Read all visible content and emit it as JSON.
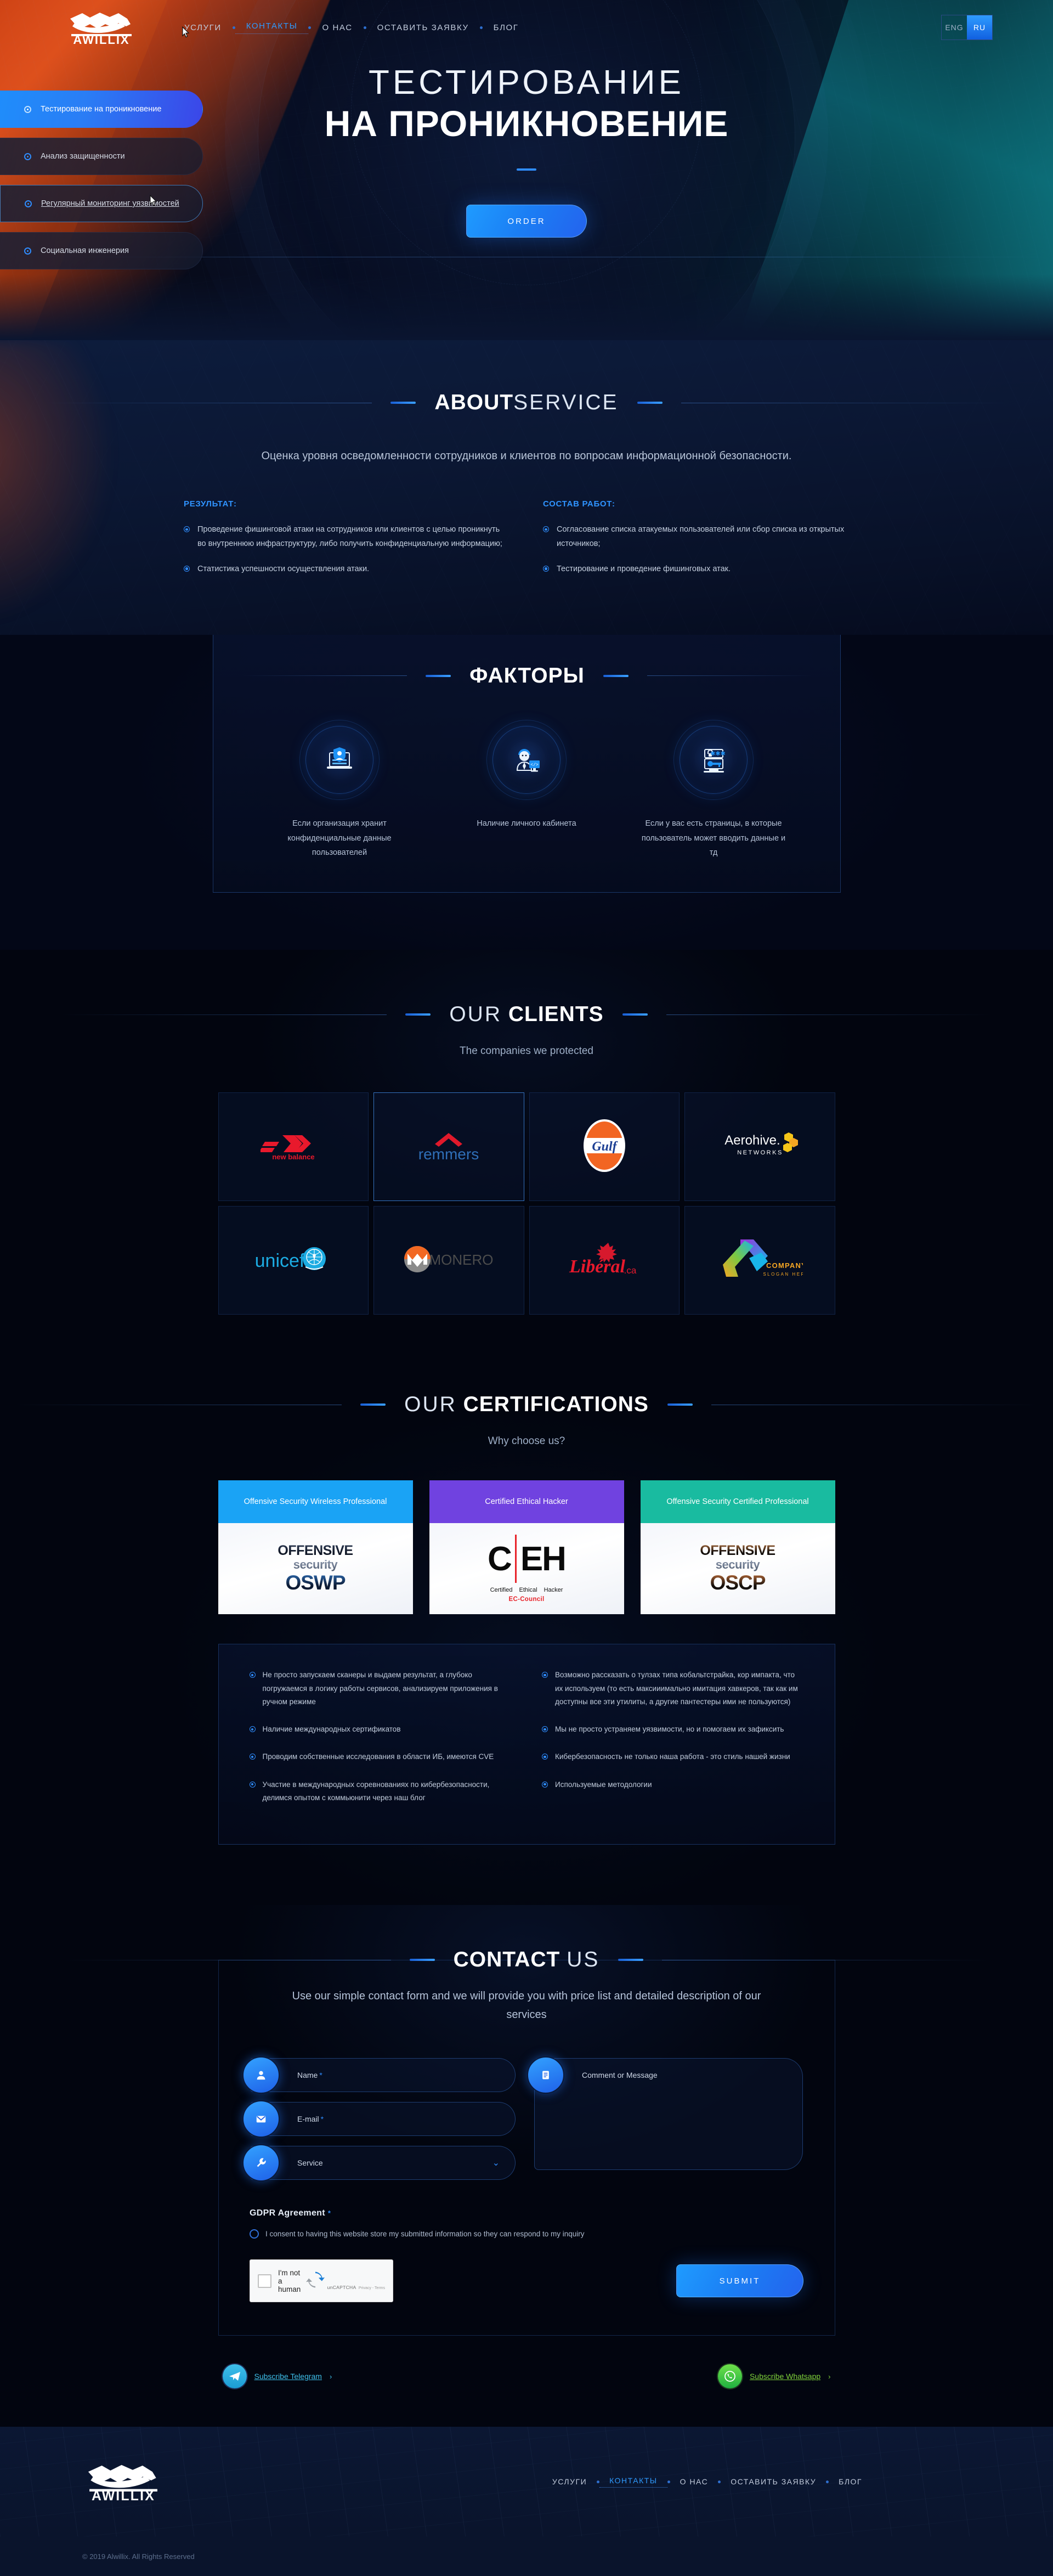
{
  "brand": {
    "name": "AWILLIX"
  },
  "nav": {
    "items": [
      {
        "label": "УСЛУГИ",
        "active": false
      },
      {
        "label": "КОНТАКТЫ",
        "active": true
      },
      {
        "label": "О НАС",
        "active": false
      },
      {
        "label": "ОСТАВИТЬ ЗАЯВКУ",
        "active": false
      },
      {
        "label": "БЛОГ",
        "active": false
      }
    ],
    "lang": {
      "eng": "ENG",
      "ru": "RU",
      "selected": "RU"
    }
  },
  "side_menu": {
    "items": [
      {
        "label": "Тестирование на проникновение",
        "state": "active"
      },
      {
        "label": "Анализ защищенности",
        "state": "normal"
      },
      {
        "label": "Регулярный мониторинг уязвимостей",
        "state": "hover"
      },
      {
        "label": "Социальная инженерия",
        "state": "normal"
      }
    ]
  },
  "hero": {
    "title_thin": "ТЕСТИРОВАНИЕ",
    "title_bold": "НА ПРОНИКНОВЕНИЕ",
    "cta": "ORDER"
  },
  "about": {
    "title_bold": "ABOUT",
    "title_light": "SERVICE",
    "lead": "Оценка уровня осведомленности сотрудников и клиентов по вопросам информационной безопасности.",
    "left": {
      "heading": "РЕЗУЛЬТАТ:",
      "items": [
        "Проведение фишинговой атаки на сотрудников или клиентов с целью проникнуть во внутреннюю инфраструктуру, либо получить конфиденциальную информацию;",
        "Статистика успешности осуществления атаки."
      ]
    },
    "right": {
      "heading": "СОСТАВ РАБОТ:",
      "items": [
        "Согласование списка атакуемых пользователей или сбор списка из открытых источников;",
        "Тестирование и проведение фишинговых атак."
      ]
    }
  },
  "factors": {
    "title": "ФАКТОРЫ",
    "cards": [
      {
        "icon": "laptop-shield-user-icon",
        "text": "Если организация хранит конфиденциальные данные пользователей"
      },
      {
        "icon": "user-developer-icon",
        "text": "Наличие личного кабинета"
      },
      {
        "icon": "password-lock-key-icon",
        "text": "Если у вас есть страницы, в которые пользователь может вводить данные и тд"
      }
    ]
  },
  "clients": {
    "title_light": "OUR",
    "title_bold": "CLIENTS",
    "subtitle": "The companies we protected",
    "logos": [
      {
        "name": "new balance",
        "id": "new-balance",
        "hl": false
      },
      {
        "name": "remmers",
        "id": "remmers",
        "hl": true
      },
      {
        "name": "Gulf",
        "id": "gulf",
        "hl": false
      },
      {
        "name": "Aerohive NETWORKS",
        "id": "aerohive",
        "hl": false
      },
      {
        "name": "unicef",
        "id": "unicef",
        "hl": false
      },
      {
        "name": "MONERO",
        "id": "monero",
        "hl": false
      },
      {
        "name": "Libéral.ca",
        "id": "liberal",
        "hl": false
      },
      {
        "name": "COMPANY SLOGAN HERE",
        "id": "company",
        "hl": false
      }
    ]
  },
  "certifications": {
    "title_light": "OUR",
    "title_bold": "CERTIFICATIONS",
    "subtitle": "Why choose us?",
    "cards": [
      {
        "header": "Offensive Security Wireless Professional",
        "color": "#1aa3f5",
        "logo": "oswp",
        "logo_top": "OFFENSIVE",
        "logo_mid": "security",
        "logo_big": "OSWP"
      },
      {
        "header": "Certified Ethical Hacker",
        "color": "#7042e0",
        "logo": "ceh",
        "ceh_c": "C",
        "ceh_eh": "EH",
        "ceh_sub1": "Certified",
        "ceh_sub2": "Ethical",
        "ceh_sub3": "Hacker",
        "ceh_ec": "EC-Council"
      },
      {
        "header": "Offensive Security Certified Professional",
        "color": "#19bba0",
        "logo": "oscp",
        "logo_top": "OFFENSIVE",
        "logo_mid": "security",
        "logo_big": "OSCP"
      }
    ],
    "benefits_left": [
      "Не просто запускаем сканеры и выдаем результат, а глубоко погружаемся в логику работы сервисов, анализируем приложения в ручном режиме",
      "Наличие международных сертификатов",
      "Проводим собственные исследования в области ИБ, имеются CVE",
      "Участие в международных соревнованиях по кибербезопасности, делимся опытом с коммьюнити через наш блог"
    ],
    "benefits_right": [
      "Возможно рассказать о тулзах типа кобальтстрайка, кор импакта, что их используем (то есть максииимально имитация хавкеров, так как им доступны все эти утилиты, а другие пантестеры ими не пользуются)",
      "Мы не просто устраняем уязвимости, но и помогаем их зафиксить",
      "Кибербезопасность не только наша работа - это стиль нашей жизни",
      "Используемые методологии"
    ]
  },
  "contact": {
    "title_bold": "CONTACT",
    "title_light": "US",
    "lead": "Use our simple contact form and we will provide you with price list and detailed description of our services",
    "fields": {
      "name": {
        "placeholder": "Name",
        "required": "*",
        "icon": "user-icon"
      },
      "email": {
        "placeholder": "E-mail",
        "required": "*",
        "icon": "envelope-icon"
      },
      "service": {
        "placeholder": "Service",
        "icon": "wrench-icon",
        "chevron": "⌄"
      },
      "message": {
        "placeholder": "Comment or Message",
        "icon": "message-icon"
      }
    },
    "gdpr": {
      "heading": "GDPR Agreement",
      "required": "*",
      "consent": "I consent to having this website store my submitted information so they can respond to my inquiry"
    },
    "captcha": {
      "label": "I'm not a human",
      "name": "unCAPTCHA",
      "terms": "Privacy - Terms"
    },
    "submit": "SUBMIT",
    "socials": [
      {
        "label": "Subscribe Telegram",
        "arrow": "›",
        "kind": "tg",
        "icon": "telegram-icon"
      },
      {
        "label": "Subscribe Whatsapp",
        "arrow": "›",
        "kind": "wa",
        "icon": "whatsapp-icon"
      }
    ]
  },
  "footer": {
    "items": [
      {
        "label": "УСЛУГИ",
        "active": false
      },
      {
        "label": "КОНТАКТЫ",
        "active": true
      },
      {
        "label": "О НАС",
        "active": false
      },
      {
        "label": "ОСТАВИТЬ ЗАЯВКУ",
        "active": false
      },
      {
        "label": "БЛОГ",
        "active": false
      }
    ],
    "copyright": "© 2019 Alwillix. All Rights Reserved"
  },
  "colors": {
    "accent": "#2f8dff",
    "bg": "#02050f",
    "orange": "#d8471a",
    "teal": "#0d5560"
  }
}
